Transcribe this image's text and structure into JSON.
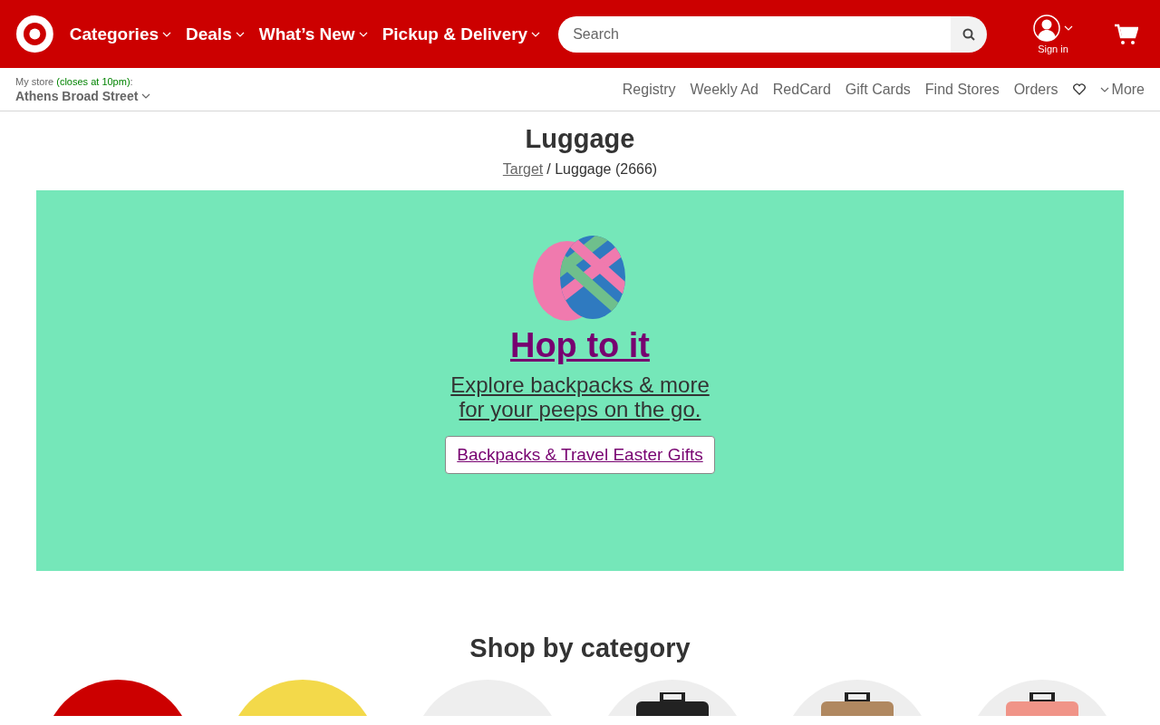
{
  "header": {
    "nav": [
      {
        "label": "Categories"
      },
      {
        "label": "Deals"
      },
      {
        "label": "What’s New"
      },
      {
        "label": "Pickup & Delivery"
      }
    ],
    "search": {
      "placeholder": "Search"
    },
    "account": {
      "label": "Sign in"
    }
  },
  "store_bar": {
    "prefix": "My store",
    "hours": "(closes at 10pm)",
    "suffix": ":",
    "store": "Athens Broad Street",
    "links": [
      "Registry",
      "Weekly Ad",
      "RedCard",
      "Gift Cards",
      "Find Stores",
      "Orders"
    ],
    "more": "More"
  },
  "page": {
    "title": "Luggage",
    "breadcrumb": {
      "link": "Target",
      "current": "/ Luggage (2666)"
    }
  },
  "banner": {
    "headline": "Hop to it",
    "subtitle_lines": [
      "Explore backpacks & more",
      "for your peeps on the go."
    ],
    "button": "Backpacks & Travel Easter Gifts"
  },
  "categories": {
    "title": "Shop by category"
  }
}
